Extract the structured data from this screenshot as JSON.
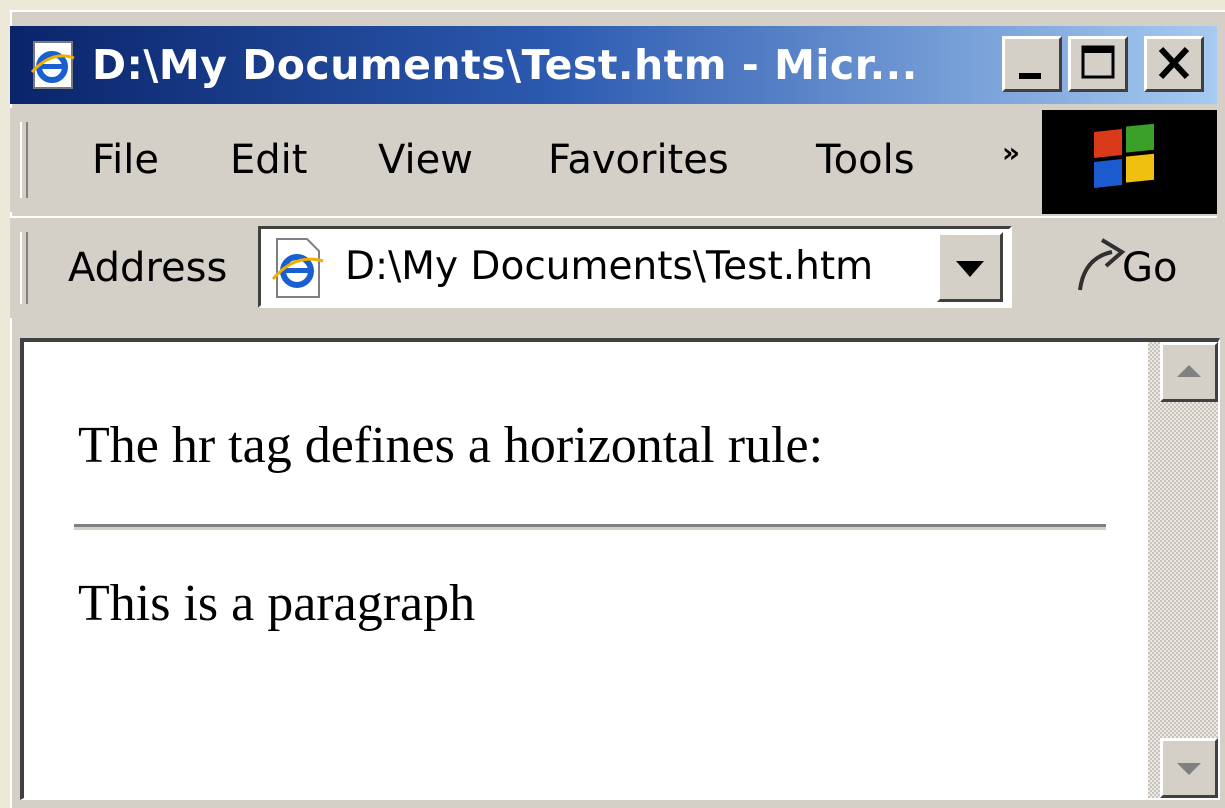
{
  "window": {
    "title": "D:\\My Documents\\Test.htm - Micr..."
  },
  "menu": {
    "items": [
      "File",
      "Edit",
      "View",
      "Favorites",
      "Tools"
    ],
    "overflow_label": "»"
  },
  "address": {
    "label": "Address",
    "value": "D:\\My Documents\\Test.htm",
    "go_label": "Go"
  },
  "page": {
    "heading": "The hr tag defines a horizontal rule:",
    "paragraph": "This is a paragraph"
  },
  "colors": {
    "title_gradient_start": "#0a246a",
    "title_gradient_end": "#a6caf0",
    "chrome": "#d4d0c8"
  }
}
